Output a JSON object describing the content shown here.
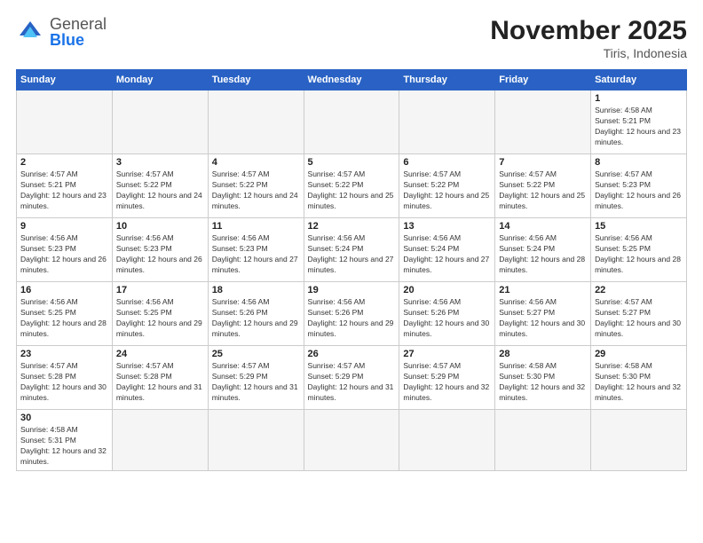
{
  "header": {
    "logo_general": "General",
    "logo_blue": "Blue",
    "month_title": "November 2025",
    "location": "Tiris, Indonesia"
  },
  "weekdays": [
    "Sunday",
    "Monday",
    "Tuesday",
    "Wednesday",
    "Thursday",
    "Friday",
    "Saturday"
  ],
  "days": {
    "d1": {
      "num": "1",
      "info": "Sunrise: 4:58 AM\nSunset: 5:21 PM\nDaylight: 12 hours and 23 minutes."
    },
    "d2": {
      "num": "2",
      "info": "Sunrise: 4:57 AM\nSunset: 5:21 PM\nDaylight: 12 hours and 23 minutes."
    },
    "d3": {
      "num": "3",
      "info": "Sunrise: 4:57 AM\nSunset: 5:22 PM\nDaylight: 12 hours and 24 minutes."
    },
    "d4": {
      "num": "4",
      "info": "Sunrise: 4:57 AM\nSunset: 5:22 PM\nDaylight: 12 hours and 24 minutes."
    },
    "d5": {
      "num": "5",
      "info": "Sunrise: 4:57 AM\nSunset: 5:22 PM\nDaylight: 12 hours and 25 minutes."
    },
    "d6": {
      "num": "6",
      "info": "Sunrise: 4:57 AM\nSunset: 5:22 PM\nDaylight: 12 hours and 25 minutes."
    },
    "d7": {
      "num": "7",
      "info": "Sunrise: 4:57 AM\nSunset: 5:22 PM\nDaylight: 12 hours and 25 minutes."
    },
    "d8": {
      "num": "8",
      "info": "Sunrise: 4:57 AM\nSunset: 5:23 PM\nDaylight: 12 hours and 26 minutes."
    },
    "d9": {
      "num": "9",
      "info": "Sunrise: 4:56 AM\nSunset: 5:23 PM\nDaylight: 12 hours and 26 minutes."
    },
    "d10": {
      "num": "10",
      "info": "Sunrise: 4:56 AM\nSunset: 5:23 PM\nDaylight: 12 hours and 26 minutes."
    },
    "d11": {
      "num": "11",
      "info": "Sunrise: 4:56 AM\nSunset: 5:23 PM\nDaylight: 12 hours and 27 minutes."
    },
    "d12": {
      "num": "12",
      "info": "Sunrise: 4:56 AM\nSunset: 5:24 PM\nDaylight: 12 hours and 27 minutes."
    },
    "d13": {
      "num": "13",
      "info": "Sunrise: 4:56 AM\nSunset: 5:24 PM\nDaylight: 12 hours and 27 minutes."
    },
    "d14": {
      "num": "14",
      "info": "Sunrise: 4:56 AM\nSunset: 5:24 PM\nDaylight: 12 hours and 28 minutes."
    },
    "d15": {
      "num": "15",
      "info": "Sunrise: 4:56 AM\nSunset: 5:25 PM\nDaylight: 12 hours and 28 minutes."
    },
    "d16": {
      "num": "16",
      "info": "Sunrise: 4:56 AM\nSunset: 5:25 PM\nDaylight: 12 hours and 28 minutes."
    },
    "d17": {
      "num": "17",
      "info": "Sunrise: 4:56 AM\nSunset: 5:25 PM\nDaylight: 12 hours and 29 minutes."
    },
    "d18": {
      "num": "18",
      "info": "Sunrise: 4:56 AM\nSunset: 5:26 PM\nDaylight: 12 hours and 29 minutes."
    },
    "d19": {
      "num": "19",
      "info": "Sunrise: 4:56 AM\nSunset: 5:26 PM\nDaylight: 12 hours and 29 minutes."
    },
    "d20": {
      "num": "20",
      "info": "Sunrise: 4:56 AM\nSunset: 5:26 PM\nDaylight: 12 hours and 30 minutes."
    },
    "d21": {
      "num": "21",
      "info": "Sunrise: 4:56 AM\nSunset: 5:27 PM\nDaylight: 12 hours and 30 minutes."
    },
    "d22": {
      "num": "22",
      "info": "Sunrise: 4:57 AM\nSunset: 5:27 PM\nDaylight: 12 hours and 30 minutes."
    },
    "d23": {
      "num": "23",
      "info": "Sunrise: 4:57 AM\nSunset: 5:28 PM\nDaylight: 12 hours and 30 minutes."
    },
    "d24": {
      "num": "24",
      "info": "Sunrise: 4:57 AM\nSunset: 5:28 PM\nDaylight: 12 hours and 31 minutes."
    },
    "d25": {
      "num": "25",
      "info": "Sunrise: 4:57 AM\nSunset: 5:29 PM\nDaylight: 12 hours and 31 minutes."
    },
    "d26": {
      "num": "26",
      "info": "Sunrise: 4:57 AM\nSunset: 5:29 PM\nDaylight: 12 hours and 31 minutes."
    },
    "d27": {
      "num": "27",
      "info": "Sunrise: 4:57 AM\nSunset: 5:29 PM\nDaylight: 12 hours and 32 minutes."
    },
    "d28": {
      "num": "28",
      "info": "Sunrise: 4:58 AM\nSunset: 5:30 PM\nDaylight: 12 hours and 32 minutes."
    },
    "d29": {
      "num": "29",
      "info": "Sunrise: 4:58 AM\nSunset: 5:30 PM\nDaylight: 12 hours and 32 minutes."
    },
    "d30": {
      "num": "30",
      "info": "Sunrise: 4:58 AM\nSunset: 5:31 PM\nDaylight: 12 hours and 32 minutes."
    }
  }
}
